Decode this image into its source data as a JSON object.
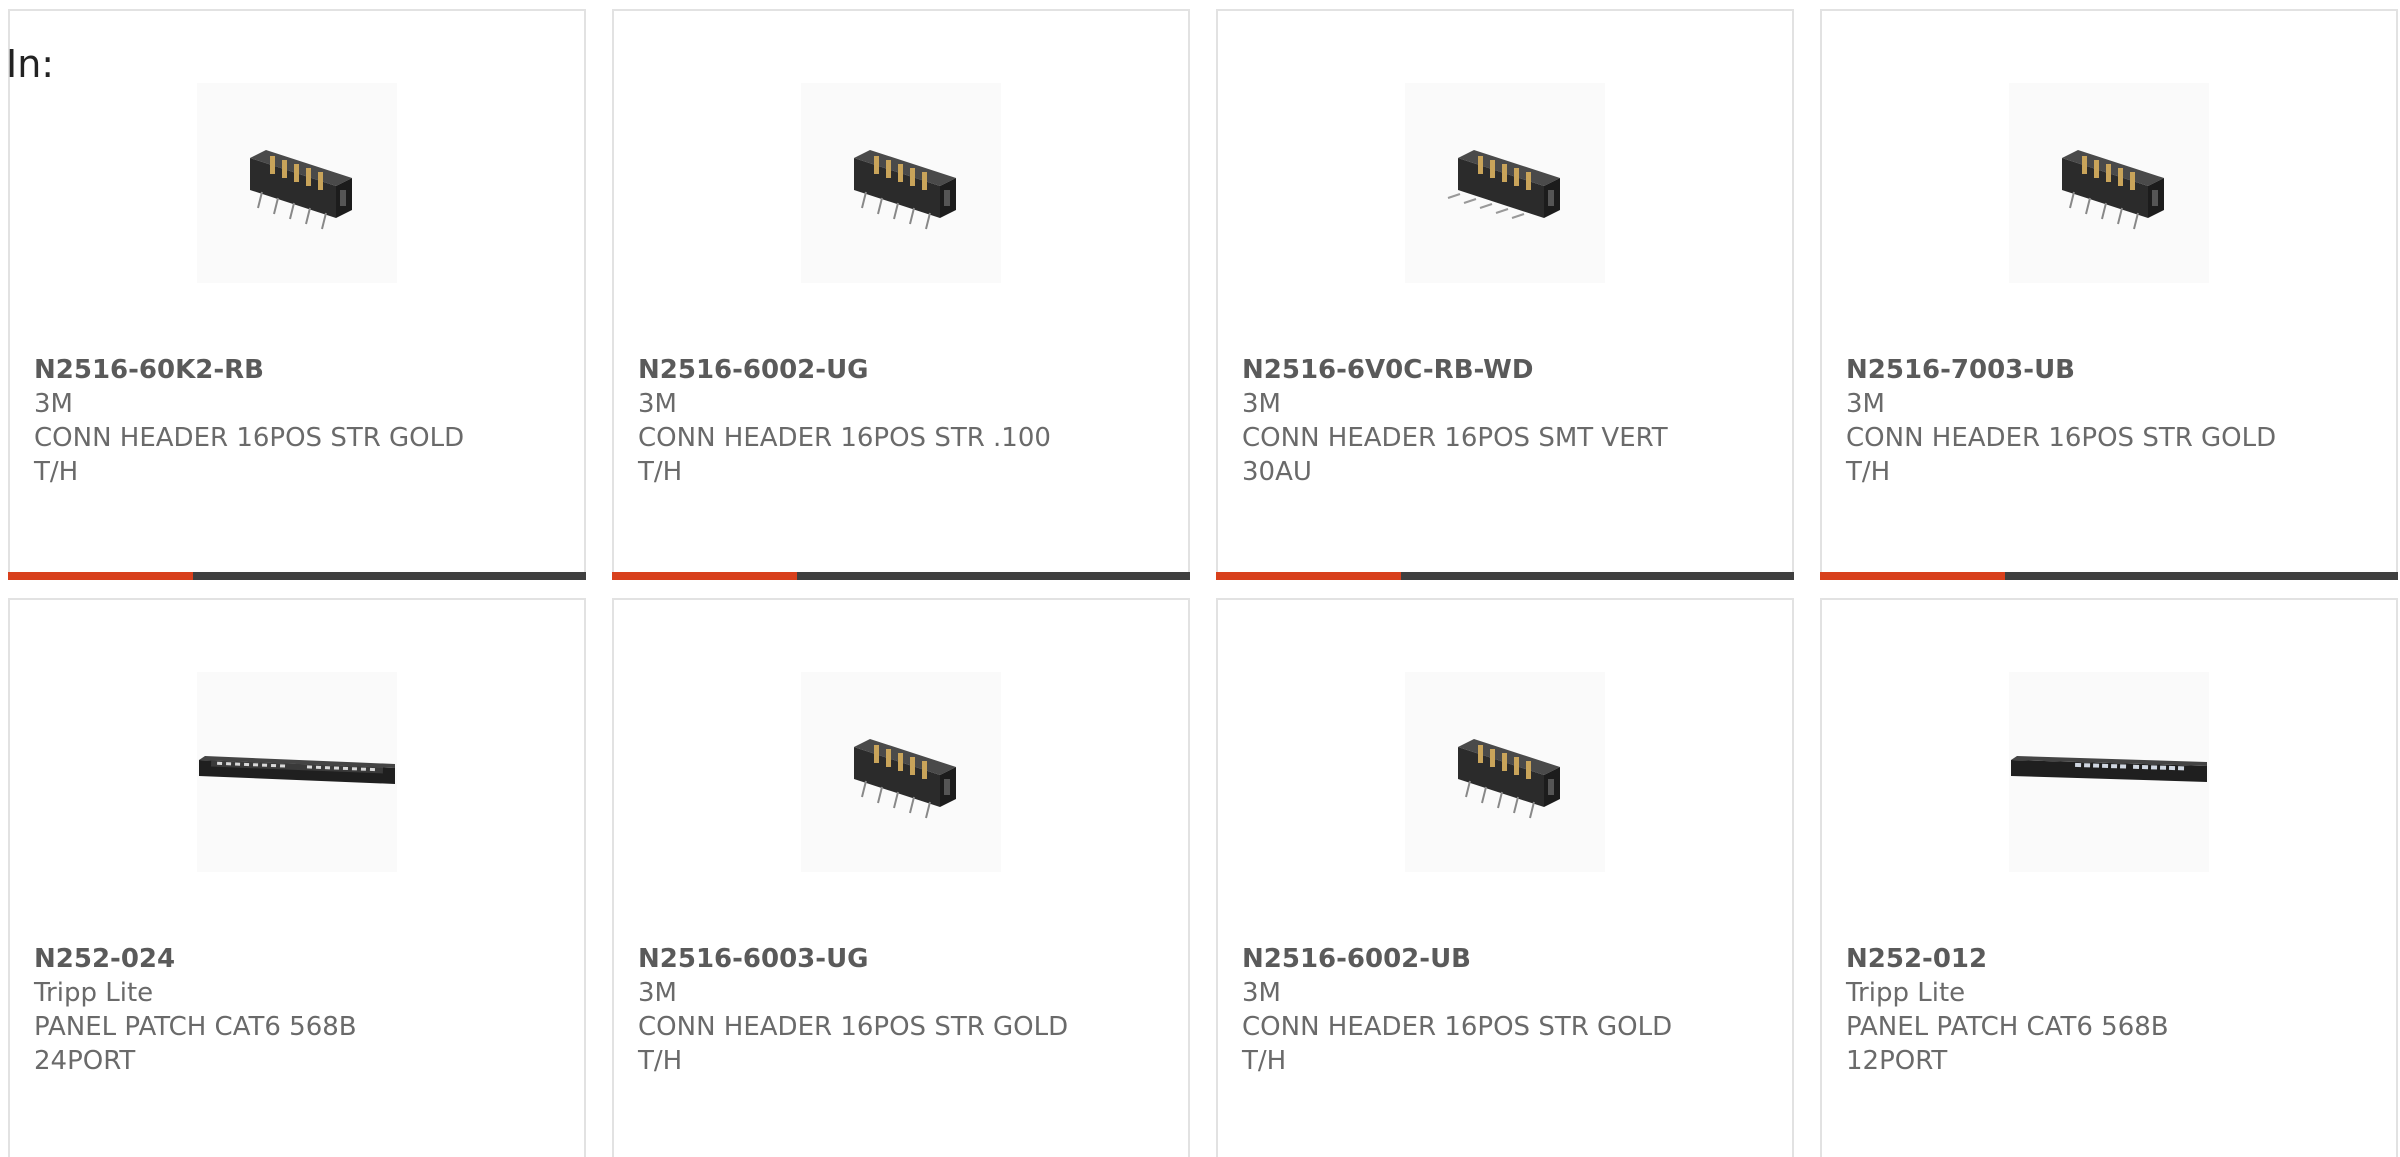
{
  "filter_label": "In:",
  "colors": {
    "accent": "#d8401c",
    "bar_dark": "#3f3f3f",
    "text": "#666666"
  },
  "products": [
    {
      "part": "N2516-60K2-RB",
      "maker": "3M",
      "desc_line1": "CONN HEADER 16POS STR GOLD",
      "desc_line2": "T/H",
      "image_icon": "pin-header-icon",
      "progress": 0.32
    },
    {
      "part": "N2516-6002-UG",
      "maker": "3M",
      "desc_line1": "CONN HEADER 16POS STR .100",
      "desc_line2": "T/H",
      "image_icon": "pin-header-icon",
      "progress": 0.32
    },
    {
      "part": "N2516-6V0C-RB-WD",
      "maker": "3M",
      "desc_line1": "CONN HEADER 16POS SMT VERT",
      "desc_line2": "30AU",
      "image_icon": "pin-header-icon",
      "progress": 0.32
    },
    {
      "part": "N2516-7003-UB",
      "maker": "3M",
      "desc_line1": "CONN HEADER 16POS STR GOLD",
      "desc_line2": "T/H",
      "image_icon": "pin-header-icon",
      "progress": 0.32
    },
    {
      "part": "N252-024",
      "maker": "Tripp Lite",
      "desc_line1": "PANEL PATCH CAT6 568B",
      "desc_line2": "24PORT",
      "image_icon": "patch-panel-icon"
    },
    {
      "part": "N2516-6003-UG",
      "maker": "3M",
      "desc_line1": "CONN HEADER 16POS STR GOLD",
      "desc_line2": "T/H",
      "image_icon": "pin-header-icon"
    },
    {
      "part": "N2516-6002-UB",
      "maker": "3M",
      "desc_line1": "CONN HEADER 16POS STR GOLD",
      "desc_line2": "T/H",
      "image_icon": "pin-header-icon"
    },
    {
      "part": "N252-012",
      "maker": "Tripp Lite",
      "desc_line1": "PANEL PATCH CAT6 568B",
      "desc_line2": "12PORT",
      "image_icon": "patch-panel-icon"
    }
  ]
}
